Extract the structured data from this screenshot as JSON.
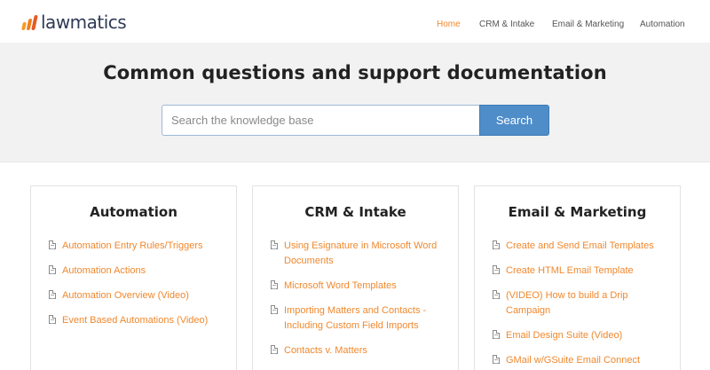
{
  "brand": {
    "name": "lawmatics"
  },
  "nav": {
    "items": [
      {
        "label": "Home",
        "active": true
      },
      {
        "label": "CRM & Intake"
      },
      {
        "label": "Email & Marketing"
      },
      {
        "label": "Automation"
      }
    ]
  },
  "hero": {
    "title": "Common questions and support documentation",
    "search_placeholder": "Search the knowledge base",
    "search_value": "",
    "search_button": "Search"
  },
  "categories": [
    {
      "title": "Automation",
      "articles": [
        "Automation Entry Rules/Triggers",
        "Automation Actions",
        "Automation Overview (Video)",
        "Event Based Automations (Video)"
      ]
    },
    {
      "title": "CRM & Intake",
      "articles": [
        "Using Esignature in Microsoft Word Documents",
        "Microsoft Word Templates",
        "Importing Matters and Contacts - Including Custom Field Imports",
        "Contacts v. Matters"
      ]
    },
    {
      "title": "Email & Marketing",
      "articles": [
        "Create and Send Email Templates",
        "Create HTML Email Template",
        "(VIDEO) How to build a Drip Campaign",
        "Email Design Suite (Video)",
        "GMail w/GSuite Email Connect"
      ]
    }
  ],
  "colors": {
    "accent": "#f0882d",
    "search_button": "#4f8dc9",
    "hero_bg": "#f2f2f2"
  },
  "icons": {
    "article": "document-icon"
  }
}
